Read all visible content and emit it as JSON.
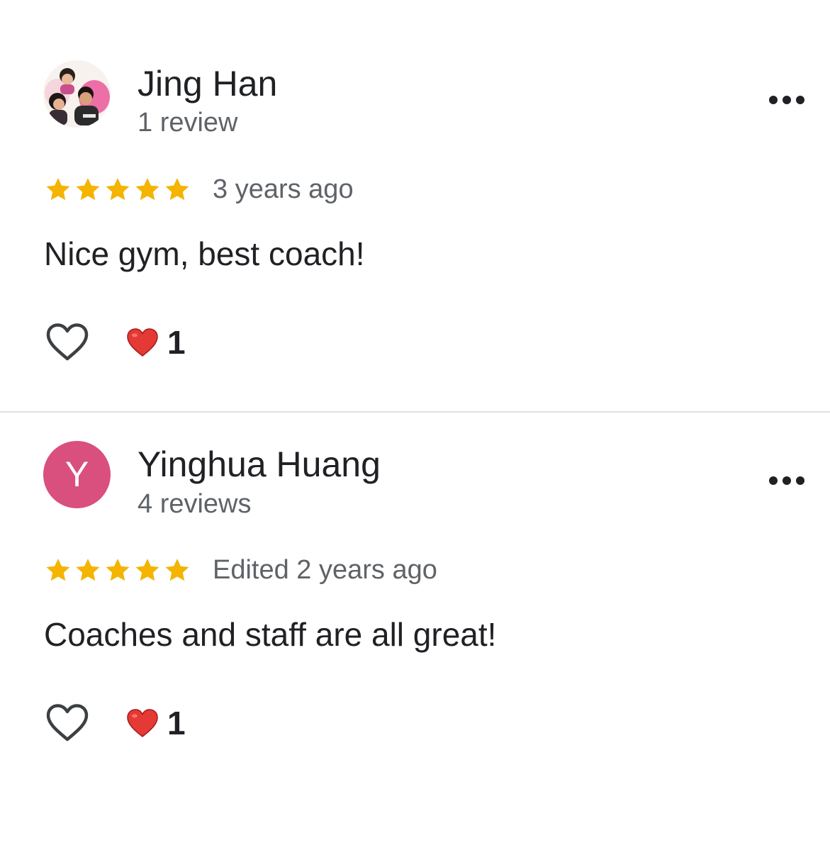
{
  "reviews": [
    {
      "author": "Jing Han",
      "review_count": "1 review",
      "rating": 5,
      "timestamp": "3 years ago",
      "text": "Nice gym, best coach!",
      "reaction_count": "1",
      "avatar": "photo"
    },
    {
      "author": "Yinghua Huang",
      "avatar_letter": "Y",
      "review_count": "4 reviews",
      "rating": 5,
      "timestamp": "Edited 2 years ago",
      "text": "Coaches and staff are all great!",
      "reaction_count": "1",
      "avatar_color": "#d94f7d"
    }
  ],
  "colors": {
    "star": "#f4b400",
    "heart_reaction": "#e53935",
    "secondary_text": "#5f6368",
    "primary_text": "#202124"
  },
  "icons": {
    "more": "more-horizontal-icon",
    "like": "heart-outline-icon",
    "reaction": "red-heart-icon",
    "star": "star-icon"
  }
}
